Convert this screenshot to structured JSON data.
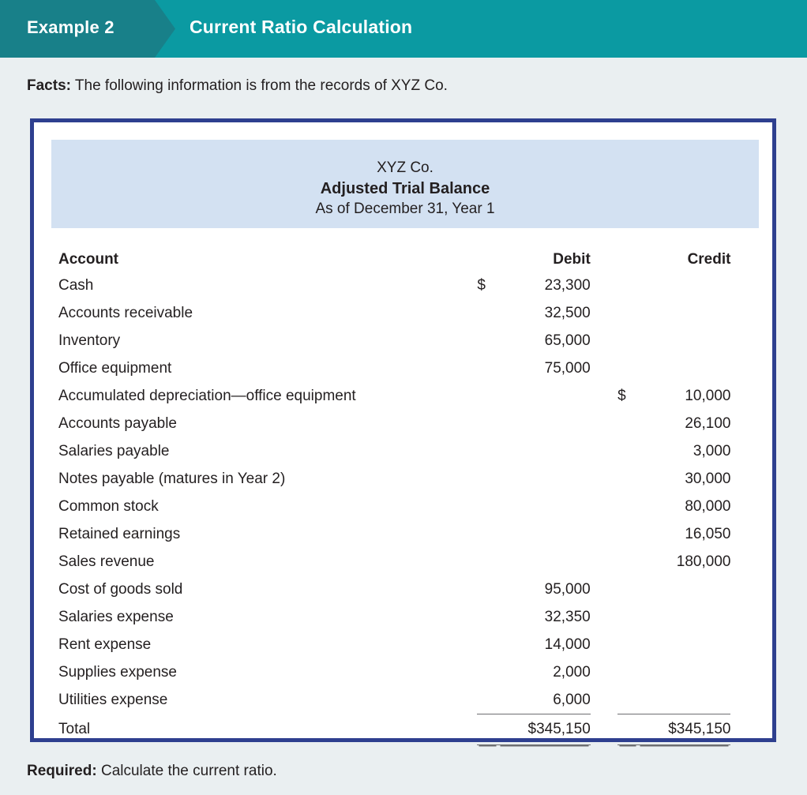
{
  "header": {
    "example_label": "Example 2",
    "title": "Current Ratio Calculation",
    "tab_color": "#188089",
    "band_color": "#0b9aa2"
  },
  "facts": {
    "lead": "Facts:",
    "text": " The following information is from the records of XYZ Co."
  },
  "statement": {
    "company": "XYZ Co.",
    "title": "Adjusted Trial Balance",
    "date_line": "As of December 31, Year 1",
    "heading_bg": "#d3e1f2",
    "border_color": "#2e3f8f"
  },
  "table": {
    "headers": {
      "account": "Account",
      "debit": "Debit",
      "credit": "Credit"
    },
    "rows": [
      {
        "account": "Cash",
        "debit_symbol": "$",
        "debit": "23,300",
        "credit_symbol": "",
        "credit": ""
      },
      {
        "account": "Accounts receivable",
        "debit_symbol": "",
        "debit": "32,500",
        "credit_symbol": "",
        "credit": ""
      },
      {
        "account": "Inventory",
        "debit_symbol": "",
        "debit": "65,000",
        "credit_symbol": "",
        "credit": ""
      },
      {
        "account": "Office equipment",
        "debit_symbol": "",
        "debit": "75,000",
        "credit_symbol": "",
        "credit": ""
      },
      {
        "account": "Accumulated depreciation—office equipment",
        "debit_symbol": "",
        "debit": "",
        "credit_symbol": "$",
        "credit": "10,000"
      },
      {
        "account": "Accounts payable",
        "debit_symbol": "",
        "debit": "",
        "credit_symbol": "",
        "credit": "26,100"
      },
      {
        "account": "Salaries payable",
        "debit_symbol": "",
        "debit": "",
        "credit_symbol": "",
        "credit": "3,000"
      },
      {
        "account": "Notes payable (matures in Year 2)",
        "debit_symbol": "",
        "debit": "",
        "credit_symbol": "",
        "credit": "30,000"
      },
      {
        "account": "Common stock",
        "debit_symbol": "",
        "debit": "",
        "credit_symbol": "",
        "credit": "80,000"
      },
      {
        "account": "Retained earnings",
        "debit_symbol": "",
        "debit": "",
        "credit_symbol": "",
        "credit": "16,050"
      },
      {
        "account": "Sales revenue",
        "debit_symbol": "",
        "debit": "",
        "credit_symbol": "",
        "credit": "180,000"
      },
      {
        "account": "Cost of goods sold",
        "debit_symbol": "",
        "debit": "95,000",
        "credit_symbol": "",
        "credit": ""
      },
      {
        "account": "Salaries expense",
        "debit_symbol": "",
        "debit": "32,350",
        "credit_symbol": "",
        "credit": ""
      },
      {
        "account": "Rent expense",
        "debit_symbol": "",
        "debit": "14,000",
        "credit_symbol": "",
        "credit": ""
      },
      {
        "account": "Supplies expense",
        "debit_symbol": "",
        "debit": "2,000",
        "credit_symbol": "",
        "credit": ""
      },
      {
        "account": "Utilities expense",
        "debit_symbol": "",
        "debit": "6,000",
        "credit_symbol": "",
        "credit": ""
      }
    ],
    "total": {
      "account": "Total",
      "debit": "$345,150",
      "credit": "$345,150"
    }
  },
  "required": {
    "lead": "Required:",
    "text": " Calculate the current ratio."
  }
}
